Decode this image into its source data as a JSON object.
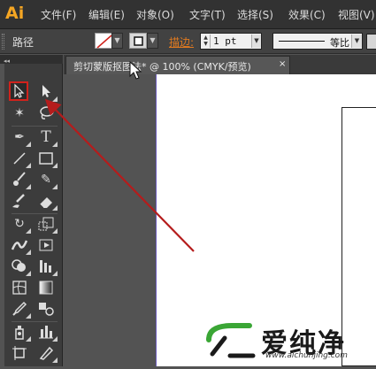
{
  "app": {
    "logo": "Ai"
  },
  "menu": [
    "文件(F)",
    "编辑(E)",
    "对象(O)",
    "文字(T)",
    "选择(S)",
    "效果(C)",
    "视图(V)"
  ],
  "control_bar": {
    "selection_label": "路径",
    "stroke_label": "描边:",
    "stroke_weight": "1 pt",
    "profile_label": "等比"
  },
  "document_tab": {
    "title": "剪切蒙版抠图法* @ 100% (CMYK/预览)",
    "close": "×"
  },
  "watermark": {
    "name": "爱纯净",
    "url": "www.aichunjing.com"
  },
  "colors": {
    "logo": "#f5a623",
    "selected_tool_highlight": "#d0221c",
    "annotation_arrow": "#b51c1c",
    "watermark_green": "#3aa635"
  },
  "tools": [
    "selection-tool-icon",
    "direct-selection-tool-icon",
    "magic-wand-tool-icon",
    "lasso-tool-icon",
    "pen-tool-icon",
    "type-tool-icon",
    "line-tool-icon",
    "rectangle-tool-icon",
    "paintbrush-tool-icon",
    "pencil-tool-icon",
    "blob-brush-tool-icon",
    "eraser-tool-icon",
    "rotate-tool-icon",
    "scale-tool-icon",
    "width-tool-icon",
    "free-transform-tool-icon",
    "shape-builder-tool-icon",
    "perspective-grid-tool-icon",
    "mesh-tool-icon",
    "gradient-tool-icon",
    "eyedropper-tool-icon",
    "blend-tool-icon",
    "symbol-sprayer-tool-icon",
    "column-graph-tool-icon",
    "artboard-tool-icon",
    "slice-tool-icon"
  ]
}
